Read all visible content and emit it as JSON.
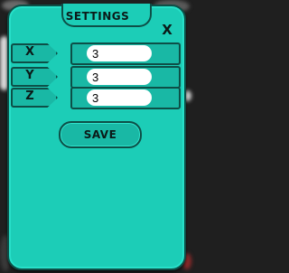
{
  "dialog": {
    "title": "SETTINGS",
    "close_label": "X"
  },
  "fields": [
    {
      "label": "X",
      "value": "3"
    },
    {
      "label": "Y",
      "value": "3"
    },
    {
      "label": "Z",
      "value": "3"
    }
  ],
  "actions": {
    "save_label": "SAVE"
  },
  "colors": {
    "panel": "#1ccdb7",
    "panel_border": "#0d4f47",
    "input_bg": "#ffffff",
    "text": "#0b1a18"
  }
}
